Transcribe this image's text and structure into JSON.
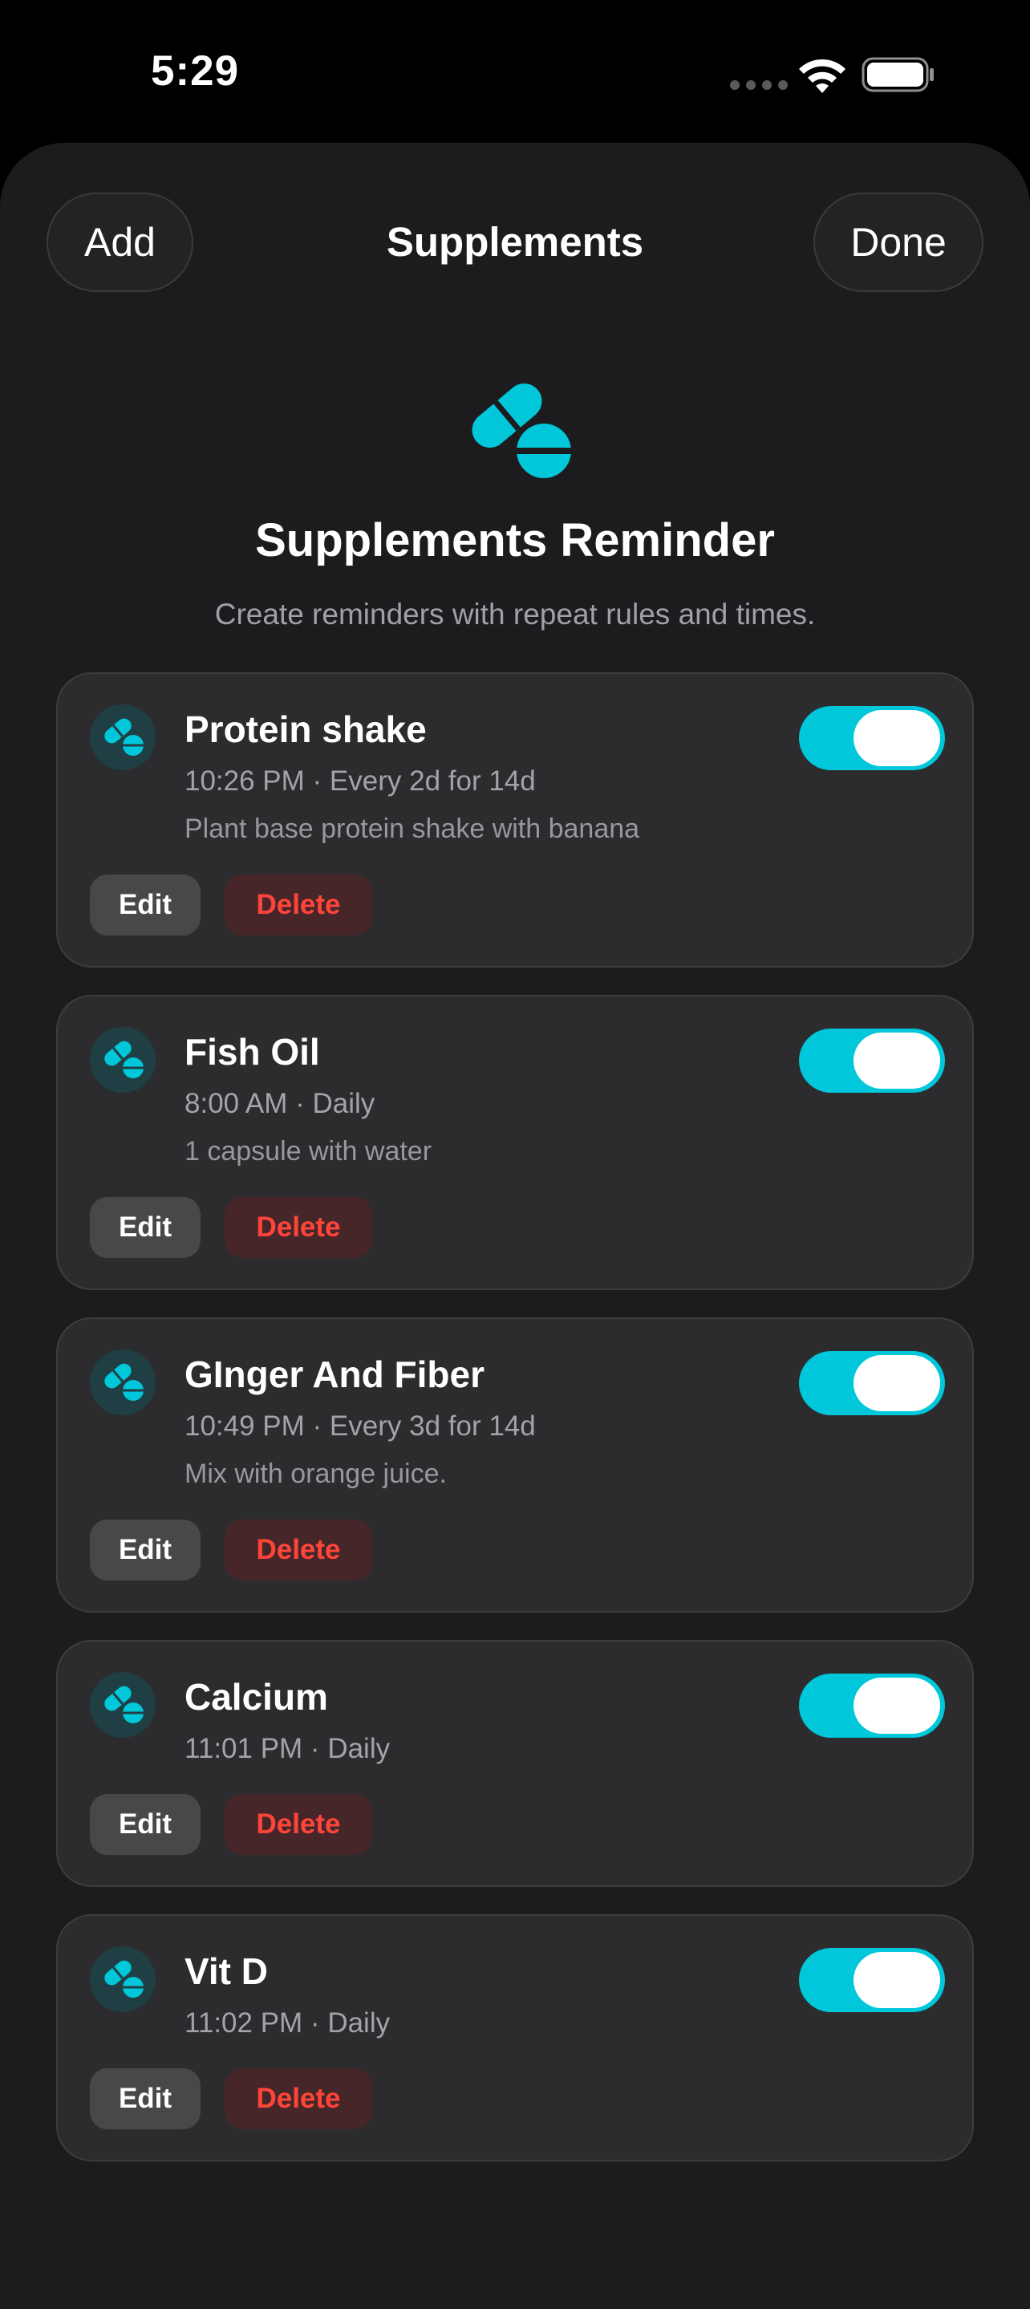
{
  "status_bar": {
    "time": "5:29"
  },
  "nav": {
    "add_label": "Add",
    "title": "Supplements",
    "done_label": "Done"
  },
  "hero": {
    "icon": "pills-icon",
    "title": "Supplements Reminder",
    "subtitle": "Create reminders with repeat rules and times."
  },
  "colors": {
    "accent": "#00c7d9",
    "background": "#1c1c1e",
    "card": "#2c2c2e",
    "destructive": "#ff453a"
  },
  "reminders": [
    {
      "title": "Protein shake",
      "schedule": "10:26 PM · Every 2d for 14d",
      "note": "Plant base protein shake with banana",
      "enabled": true,
      "edit_label": "Edit",
      "delete_label": "Delete"
    },
    {
      "title": "Fish Oil",
      "schedule": "8:00 AM · Daily",
      "note": "1 capsule with water",
      "enabled": true,
      "edit_label": "Edit",
      "delete_label": "Delete"
    },
    {
      "title": "GInger And Fiber",
      "schedule": "10:49 PM · Every 3d for 14d",
      "note": "Mix with orange juice.",
      "enabled": true,
      "edit_label": "Edit",
      "delete_label": "Delete"
    },
    {
      "title": "Calcium",
      "schedule": "11:01 PM · Daily",
      "enabled": true,
      "edit_label": "Edit",
      "delete_label": "Delete"
    },
    {
      "title": "Vit D",
      "schedule": "11:02 PM · Daily",
      "enabled": true,
      "edit_label": "Edit",
      "delete_label": "Delete"
    }
  ]
}
